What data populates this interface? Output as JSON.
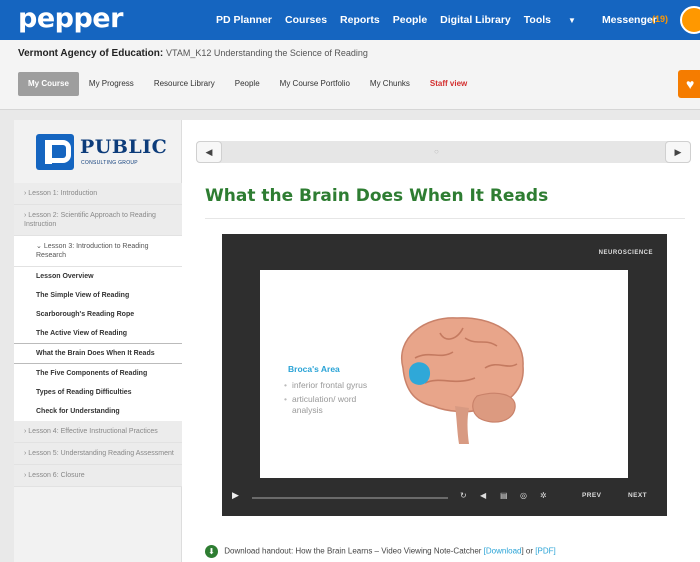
{
  "app": {
    "logo": "pepper"
  },
  "topnav": {
    "items": [
      "PD Planner",
      "Courses",
      "Reports",
      "People",
      "Digital Library",
      "Tools",
      "Messenger"
    ],
    "messenger_count": "(19)"
  },
  "course": {
    "agency": "Vermont Agency of Education:",
    "name": "VTAM_K12 Understanding the Science of Reading",
    "tabs": [
      "My Course",
      "My Progress",
      "Resource Library",
      "People",
      "My Course Portfolio",
      "My Chunks",
      "Staff view"
    ],
    "active_tab": "My Course"
  },
  "brand": {
    "word": "PUBLIC",
    "tagline": "CONSULTING GROUP"
  },
  "sidebar": {
    "items": [
      {
        "label": "Lesson 1: Introduction",
        "kind": "lesson"
      },
      {
        "label": "Lesson 2: Scientific Approach to Reading Instruction",
        "kind": "lesson"
      },
      {
        "label": "Lesson 3: Introduction to Reading Research",
        "kind": "open"
      },
      {
        "label": "Lesson Overview",
        "kind": "sub"
      },
      {
        "label": "The Simple View of Reading",
        "kind": "sub"
      },
      {
        "label": "Scarborough's Reading Rope",
        "kind": "sub"
      },
      {
        "label": "The Active View of Reading",
        "kind": "sub"
      },
      {
        "label": "What the Brain Does When It Reads",
        "kind": "current"
      },
      {
        "label": "The Five Components of Reading",
        "kind": "sub"
      },
      {
        "label": "Types of Reading Difficulties",
        "kind": "sub"
      },
      {
        "label": "Check for Understanding",
        "kind": "sub"
      },
      {
        "label": "Lesson 4: Effective Instructional Practices",
        "kind": "lesson"
      },
      {
        "label": "Lesson 5: Understanding Reading Assessment",
        "kind": "lesson"
      },
      {
        "label": "Lesson 6: Closure",
        "kind": "lesson"
      }
    ]
  },
  "page": {
    "title": "What the Brain Does When It Reads"
  },
  "video": {
    "brand": "NEUROSCIENCE",
    "area_title": "Broca's Area",
    "bullets": [
      "inferior frontal gyrus",
      "articulation/ word analysis"
    ],
    "prev": "PREV",
    "next": "NEXT",
    "progress": 0
  },
  "download": {
    "text": "Download handout: How the Brain Learns – Video Viewing Note-Catcher",
    "link1": "[Download",
    "sep": "] or",
    "link2": "[PDF]"
  },
  "colors": {
    "topbar": "#1565c0",
    "title_green": "#2e7d32",
    "accent_blue": "#29a3d6",
    "staff_red": "#d32f2f",
    "orange": "#f57c00"
  }
}
